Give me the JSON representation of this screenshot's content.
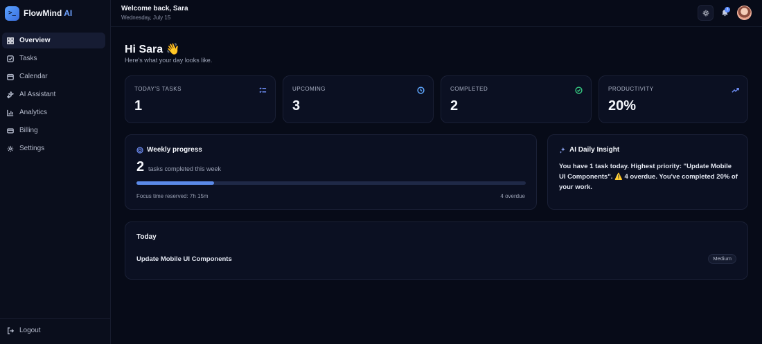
{
  "brand": {
    "logo_glyph": ">_",
    "name": "FlowMind",
    "suffix": "AI",
    "accent": "#6ea2ff"
  },
  "sidebar": {
    "items": [
      {
        "label": "Overview",
        "icon": "grid-icon",
        "active": true
      },
      {
        "label": "Tasks",
        "icon": "checkbox-icon"
      },
      {
        "label": "Calendar",
        "icon": "calendar-icon"
      },
      {
        "label": "AI Assistant",
        "icon": "sparkles-icon"
      },
      {
        "label": "Analytics",
        "icon": "bar-chart-icon"
      },
      {
        "label": "Billing",
        "icon": "credit-card-icon"
      },
      {
        "label": "Settings",
        "icon": "gear-icon"
      }
    ],
    "logout_label": "Logout"
  },
  "header": {
    "welcome": "Welcome back, Sara",
    "date": "Wednesday, July 15",
    "notification_count": "3"
  },
  "greeting": {
    "title": "Hi Sara 👋",
    "subtitle": "Here's what your day looks like."
  },
  "stats": [
    {
      "label": "TODAY'S TASKS",
      "value": "1",
      "icon": "list-check-icon",
      "color": "#6e8ef5"
    },
    {
      "label": "UPCOMING",
      "value": "3",
      "icon": "clock-icon",
      "color": "#5fa8ff"
    },
    {
      "label": "COMPLETED",
      "value": "2",
      "icon": "check-circle-icon",
      "color": "#35c57f"
    },
    {
      "label": "PRODUCTIVITY",
      "value": "20%",
      "icon": "trending-up-icon",
      "color": "#6e8ef5"
    }
  ],
  "weekly": {
    "title": "Weekly progress",
    "count": "2",
    "count_label": "tasks completed this week",
    "progress": 0.2,
    "focus": "Focus time reserved: 7h 15m",
    "overdue": "4 overdue"
  },
  "insight": {
    "title": "AI Daily Insight",
    "text": "You have 1 task today. Highest priority: \"Update Mobile UI Components\". ⚠️ 4 overdue. You've completed 20% of your work."
  },
  "today": {
    "title": "Today",
    "task": "Update Mobile UI Components",
    "priority": "Medium"
  }
}
